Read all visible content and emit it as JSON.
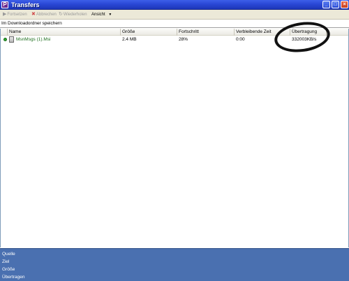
{
  "window": {
    "title": "Transfers",
    "icon_letter": "P"
  },
  "toolbar": {
    "resume_label": "Fortsetzen",
    "cancel_label": "Abbrechen",
    "retry_label": "Wiederholen",
    "view_label": "Ansicht",
    "view_dropdown_glyph": "▼"
  },
  "pathbar": {
    "text": "Im Downloadordner speichern"
  },
  "columns": [
    "Name",
    "Größe",
    "Fortschritt",
    "Verbleibende Zeit",
    "Übertragung"
  ],
  "transfers": [
    {
      "name": "MsnMsgs (1).Msi",
      "size": "2.4 MB",
      "progress": "28%",
      "remaining": "0:00",
      "rate": "332003KB/s",
      "status_color": "#2ea82e"
    }
  ],
  "infopanel": {
    "source_label": "Quelle",
    "target_label": "Ziel",
    "size_label": "Größe",
    "transferred_label": "Übertragen"
  },
  "colors": {
    "title_bar": "#2a48d6",
    "info_panel": "#4a70b0",
    "file_name": "#1e6f1e"
  }
}
